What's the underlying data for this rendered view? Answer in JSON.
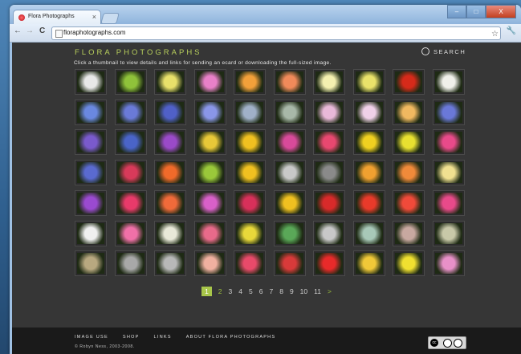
{
  "browser": {
    "tab_title": "Flora Photographs",
    "tab_close": "×",
    "url": "floraphotographs.com",
    "nav_back": "←",
    "nav_forward": "→",
    "nav_reload": "C",
    "star": "☆",
    "wrench": "🔧",
    "window_min": "–",
    "window_max": "□",
    "window_close": "X"
  },
  "site": {
    "logo": "FLORA PHOTOGRAPHS",
    "search_label": "SEARCH",
    "instructions": "Click a thumbnail to view details and links for sending an ecard or downloading the full-sized image.",
    "accent_color": "#b8cf5c"
  },
  "thumbnails": [
    [
      "#e8e8e8",
      "#8fc23a",
      "#e8e06a",
      "#e880c8",
      "#f2a03a",
      "#f08a5a",
      "#f4f0b0",
      "#eae26a",
      "#d62a1a",
      "#f0f0ea"
    ],
    [
      "#6a88e0",
      "#6a7ad8",
      "#5060c8",
      "#8a96e8",
      "#a0b0c8",
      "#a8b8a8",
      "#e8b8d8",
      "#f0d0e8",
      "#f0b860",
      "#6a78d8"
    ],
    [
      "#7a5acc",
      "#4a64c8",
      "#9a4ac8",
      "#e8c838",
      "#f0c020",
      "#d84a9a",
      "#e84870",
      "#f0d020",
      "#e8e030",
      "#e84a8a"
    ],
    [
      "#5a6ad0",
      "#d83a5a",
      "#f06a2a",
      "#9ac83a",
      "#f0c020",
      "#c8c8c8",
      "#8a8a8a",
      "#f0a030",
      "#f08a3a",
      "#f0e090"
    ],
    [
      "#9a4ad0",
      "#e83a6a",
      "#f06a3a",
      "#d860c8",
      "#d8305a",
      "#f0c020",
      "#d82a2a",
      "#e83a2a",
      "#f04a3a",
      "#e84a8a"
    ],
    [
      "#f0f0f0",
      "#f070a8",
      "#e8e8d8",
      "#e86a8a",
      "#e8d83a",
      "#5aa858",
      "#c8c8c8",
      "#a8c8b8",
      "#c8a8a0",
      "#c8c8a8"
    ],
    [
      "#b8a880",
      "#a8a8a8",
      "#b8b8b8",
      "#f0b0a0",
      "#e84a6a",
      "#d83a3a",
      "#e82a2a",
      "#f0c838",
      "#f0e030",
      "#e890c8"
    ]
  ],
  "pager": {
    "pages": [
      "1",
      "2",
      "3",
      "4",
      "5",
      "6",
      "7",
      "8",
      "9",
      "10",
      "11"
    ],
    "next": ">"
  },
  "footer": {
    "links": [
      "IMAGE USE",
      "SHOP",
      "LINKS",
      "ABOUT FLORA PHOTOGRAPHS"
    ],
    "copyright": "© Robyn Ness, 2003-2008."
  },
  "license": {
    "cc": "cc",
    "by": "BY",
    "sa": "SA"
  }
}
